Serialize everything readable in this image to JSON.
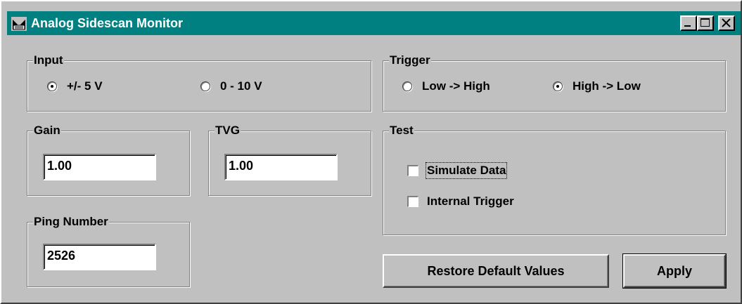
{
  "window": {
    "title": "Analog Sidescan Monitor",
    "title_bar_color": "#008080",
    "controls": [
      "minimize-icon",
      "maximize-icon",
      "close-icon"
    ]
  },
  "input": {
    "label": "Input",
    "options": [
      {
        "label": "+/- 5 V",
        "selected": true
      },
      {
        "label": "0 - 10 V",
        "selected": false
      }
    ]
  },
  "trigger": {
    "label": "Trigger",
    "options": [
      {
        "label": "Low -> High",
        "selected": false
      },
      {
        "label": "High -> Low",
        "selected": true
      }
    ]
  },
  "gain": {
    "label": "Gain",
    "value": "1.00"
  },
  "tvg": {
    "label": "TVG",
    "value": "1.00"
  },
  "ping": {
    "label": "Ping Number",
    "value": "2526"
  },
  "test": {
    "label": "Test",
    "options": [
      {
        "label": "Simulate Data",
        "checked": false
      },
      {
        "label": "Internal Trigger",
        "checked": false
      }
    ]
  },
  "buttons": {
    "restore": "Restore Default Values",
    "apply": "Apply"
  }
}
